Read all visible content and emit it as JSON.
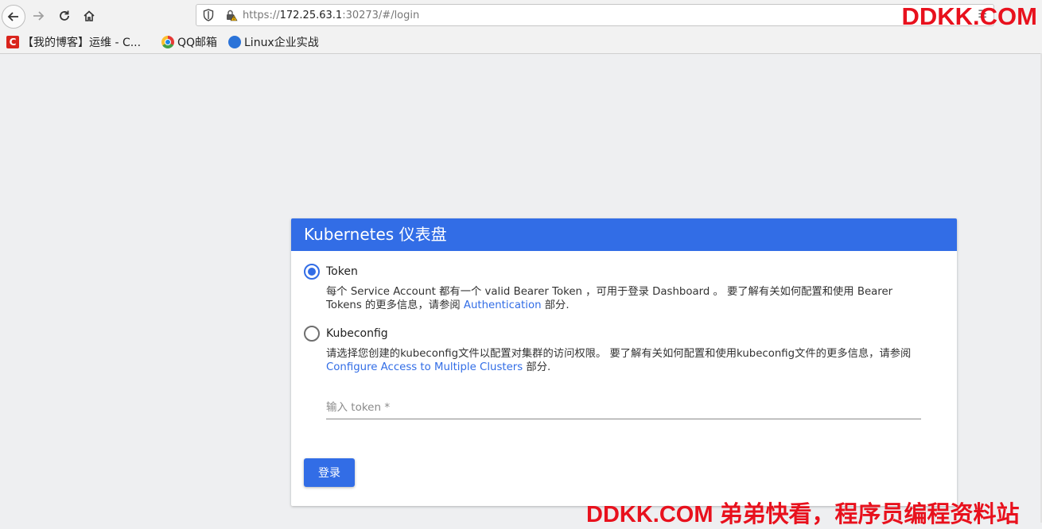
{
  "browser": {
    "url_prefix": "https://",
    "url_host": "172.25.63.1",
    "url_rest": ":30273/#/login",
    "url_end": "☰",
    "bookmarks": [
      {
        "label": "【我的博客】运维 - C...",
        "icon_glyph": "C",
        "icon": "csdn-icon"
      },
      {
        "label": "QQ邮箱",
        "icon": "qq-mail-icon"
      },
      {
        "label": "Linux企业实战",
        "icon": "linux-icon"
      }
    ]
  },
  "watermark_top": "DDKK.COM",
  "watermark_bottom": "DDKK.COM 弟弟快看，程序员编程资料站",
  "card": {
    "title": "Kubernetes 仪表盘",
    "options": [
      {
        "label": "Token",
        "selected": true,
        "desc_before": "每个 Service Account 都有一个 valid Bearer Token ，可用于登录 Dashboard 。 要了解有关如何配置和使用 Bearer Tokens 的更多信息，请参阅 ",
        "desc_link": "Authentication",
        "desc_after": " 部分."
      },
      {
        "label": "Kubeconfig",
        "selected": false,
        "desc_before": "请选择您创建的kubeconfig文件以配置对集群的访问权限。 要了解有关如何配置和使用kubeconfig文件的更多信息，请参阅",
        "desc_link": "Configure Access to Multiple Clusters",
        "desc_after": " 部分."
      }
    ],
    "token_placeholder": "输入 token *",
    "token_value": "",
    "login_label": "登录"
  },
  "colors": {
    "accent": "#326de6",
    "watermark": "#e8111d",
    "page_bg": "#eeeff1"
  }
}
